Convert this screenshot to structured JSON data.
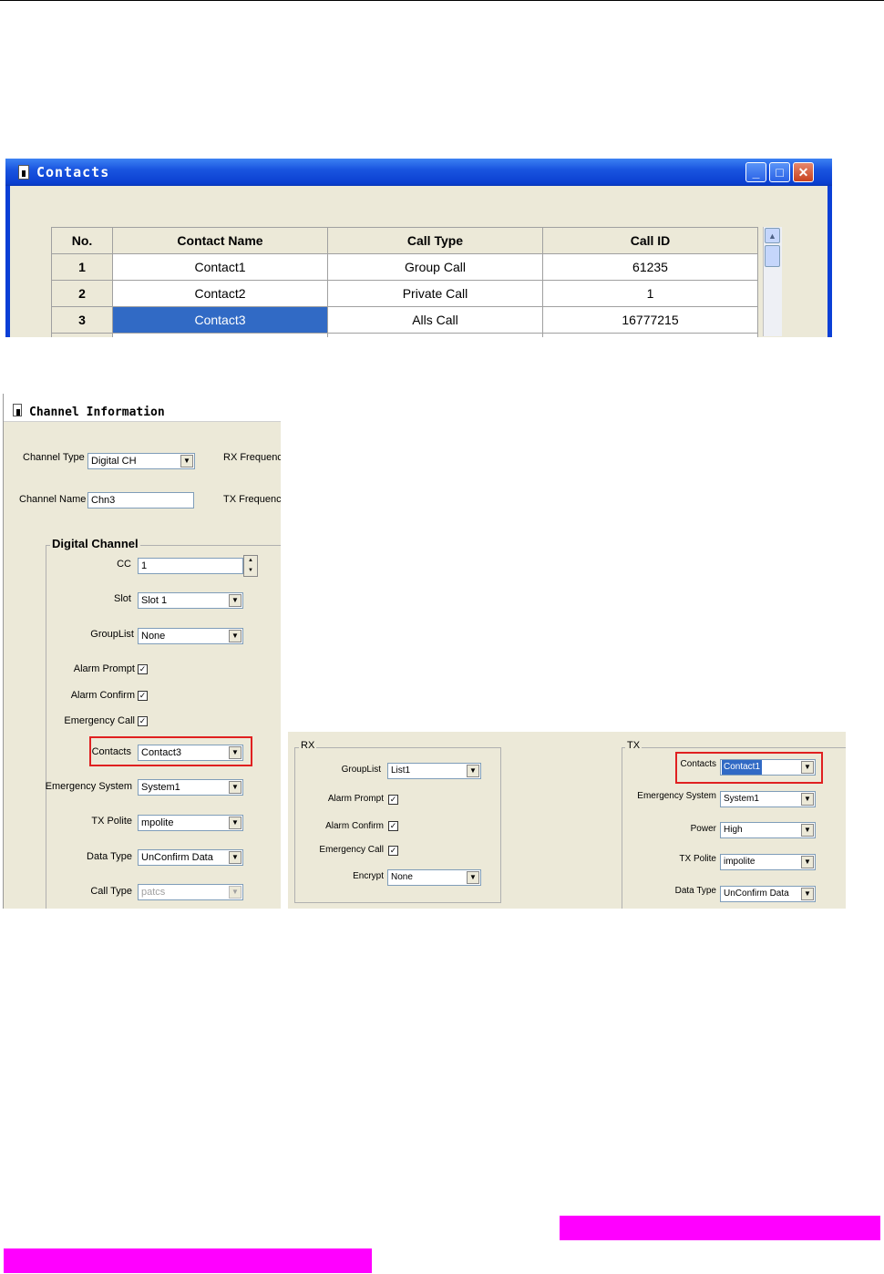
{
  "contacts_window": {
    "title": "Contacts",
    "controls": {
      "minimize": "_",
      "maximize": "□",
      "close": "✕"
    },
    "columns": [
      "No.",
      "Contact Name",
      "Call Type",
      "Call ID"
    ],
    "rows": [
      {
        "no": "1",
        "name": "Contact1",
        "call_type": "Group Call",
        "call_id": "61235"
      },
      {
        "no": "2",
        "name": "Contact2",
        "call_type": "Private Call",
        "call_id": "1"
      },
      {
        "no": "3",
        "name": "Contact3",
        "call_type": "Alls Call",
        "call_id": "16777215"
      }
    ],
    "selected_row": 3
  },
  "channel_window": {
    "title": "Channel Information",
    "channel_type": {
      "label": "Channel Type",
      "value": "Digital CH"
    },
    "channel_name": {
      "label": "Channel Name",
      "value": "Chn3"
    },
    "rx_frequency_label": "RX Frequency",
    "tx_frequency_label": "TX Frequency",
    "digital_channel": {
      "group_title": "Digital Channel",
      "cc": {
        "label": "CC",
        "value": "1"
      },
      "slot": {
        "label": "Slot",
        "value": "Slot 1"
      },
      "grouplist": {
        "label": "GroupList",
        "value": "None"
      },
      "alarm_prompt": {
        "label": "Alarm Prompt",
        "checked": true
      },
      "alarm_confirm": {
        "label": "Alarm Confirm",
        "checked": true
      },
      "emergency_call": {
        "label": "Emergency Call",
        "checked": true
      },
      "contacts": {
        "label": "Contacts",
        "value": "Contact3"
      },
      "emergency_system": {
        "label": "Emergency System",
        "value": "System1"
      },
      "tx_polite": {
        "label": "TX Polite",
        "value": "mpolite"
      },
      "data_type": {
        "label": "Data Type",
        "value": "UnConfirm Data"
      },
      "call_type": {
        "label": "Call Type",
        "value": "patcs"
      }
    }
  },
  "rxtx_panel": {
    "rx": {
      "title": "RX",
      "grouplist": {
        "label": "GroupList",
        "value": "List1"
      },
      "alarm_prompt": {
        "label": "Alarm Prompt",
        "checked": true
      },
      "alarm_confirm": {
        "label": "Alarm Confirm",
        "checked": true
      },
      "emergency_call": {
        "label": "Emergency Call",
        "checked": true
      },
      "encrypt": {
        "label": "Encrypt",
        "value": "None"
      }
    },
    "tx": {
      "title": "TX",
      "contacts": {
        "label": "Contacts",
        "value": "Contact1"
      },
      "emergency_system": {
        "label": "Emergency System",
        "value": "System1"
      },
      "power": {
        "label": "Power",
        "value": "High"
      },
      "tx_polite": {
        "label": "TX Polite",
        "value": "impolite"
      },
      "data_type": {
        "label": "Data Type",
        "value": "UnConfirm Data"
      }
    }
  },
  "check_mark": "✓",
  "dropdown_arrow": "▼",
  "colors": {
    "highlight": "#ff00ff",
    "selection": "#316ac5",
    "red_box": "#e02020",
    "xp_title": "#0a3fd0"
  }
}
